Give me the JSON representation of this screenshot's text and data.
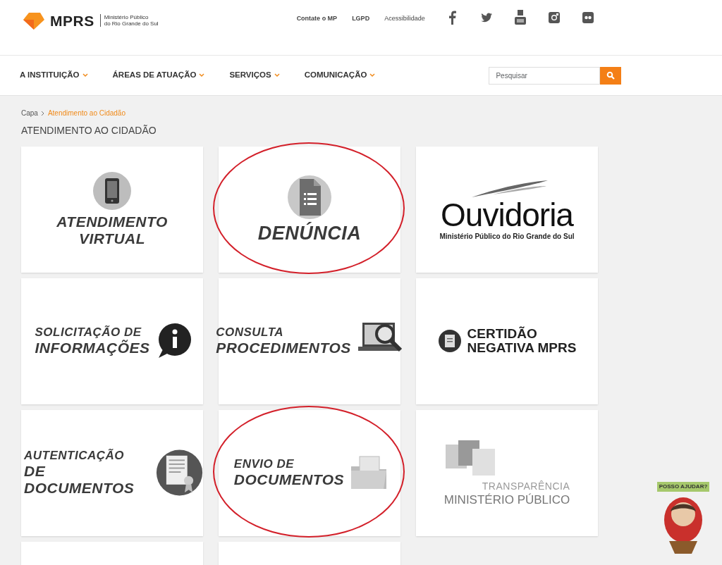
{
  "header": {
    "logo": {
      "name": "MPRS",
      "subtitle_line_1": "Ministério Público",
      "subtitle_line_2": "do Rio Grande do Sul"
    },
    "links": [
      "Contate o MP",
      "LGPD",
      "Acessibilidade"
    ]
  },
  "nav": {
    "items": [
      "A INSTITUIÇÃO",
      "ÁREAS DE ATUAÇÃO",
      "SERVIÇOS",
      "COMUNICAÇÃO"
    ],
    "search": {
      "placeholder": "Pesquisar"
    }
  },
  "breadcrumb": [
    {
      "label": "Capa",
      "current": false
    },
    {
      "label": "Atendimento ao Cidadão",
      "current": true
    }
  ],
  "page_title": "ATENDIMENTO AO CIDADÃO",
  "cards": [
    {
      "kind": "icon_top",
      "title": "ATENDIMENTO VIRTUAL",
      "circled": false
    },
    {
      "kind": "icon_top",
      "title": "DENÚNCIA",
      "circled": true
    },
    {
      "kind": "ouvidoria",
      "title": "Ouvidoria",
      "subtitle": "Ministério Público do Rio Grande do Sul",
      "circled": false
    },
    {
      "kind": "icon_right",
      "title": "SOLICITAÇÃO DE",
      "title_2": "INFORMAÇÕES",
      "circled": false
    },
    {
      "kind": "icon_right",
      "title": "CONSULTA",
      "title_2": "PROCEDIMENTOS",
      "circled": false
    },
    {
      "kind": "certidao",
      "title": "CERTIDÃO",
      "title_2": "NEGATIVA MPRS",
      "circled": false
    },
    {
      "kind": "icon_right",
      "title": "AUTENTICAÇÃO",
      "title_2": "DE DOCUMENTOS",
      "circled": false
    },
    {
      "kind": "icon_right",
      "title": "ENVIO DE",
      "title_2": "DOCUMENTOS",
      "circled": true
    },
    {
      "kind": "transparencia",
      "title": "TRANSPARÊNCIA",
      "title_2": "MINISTÉRIO PÚBLICO",
      "circled": false
    },
    {
      "kind": "cut_off"
    },
    {
      "kind": "cut_off"
    }
  ],
  "help_widget": {
    "label": "POSSO AJUDAR?"
  }
}
